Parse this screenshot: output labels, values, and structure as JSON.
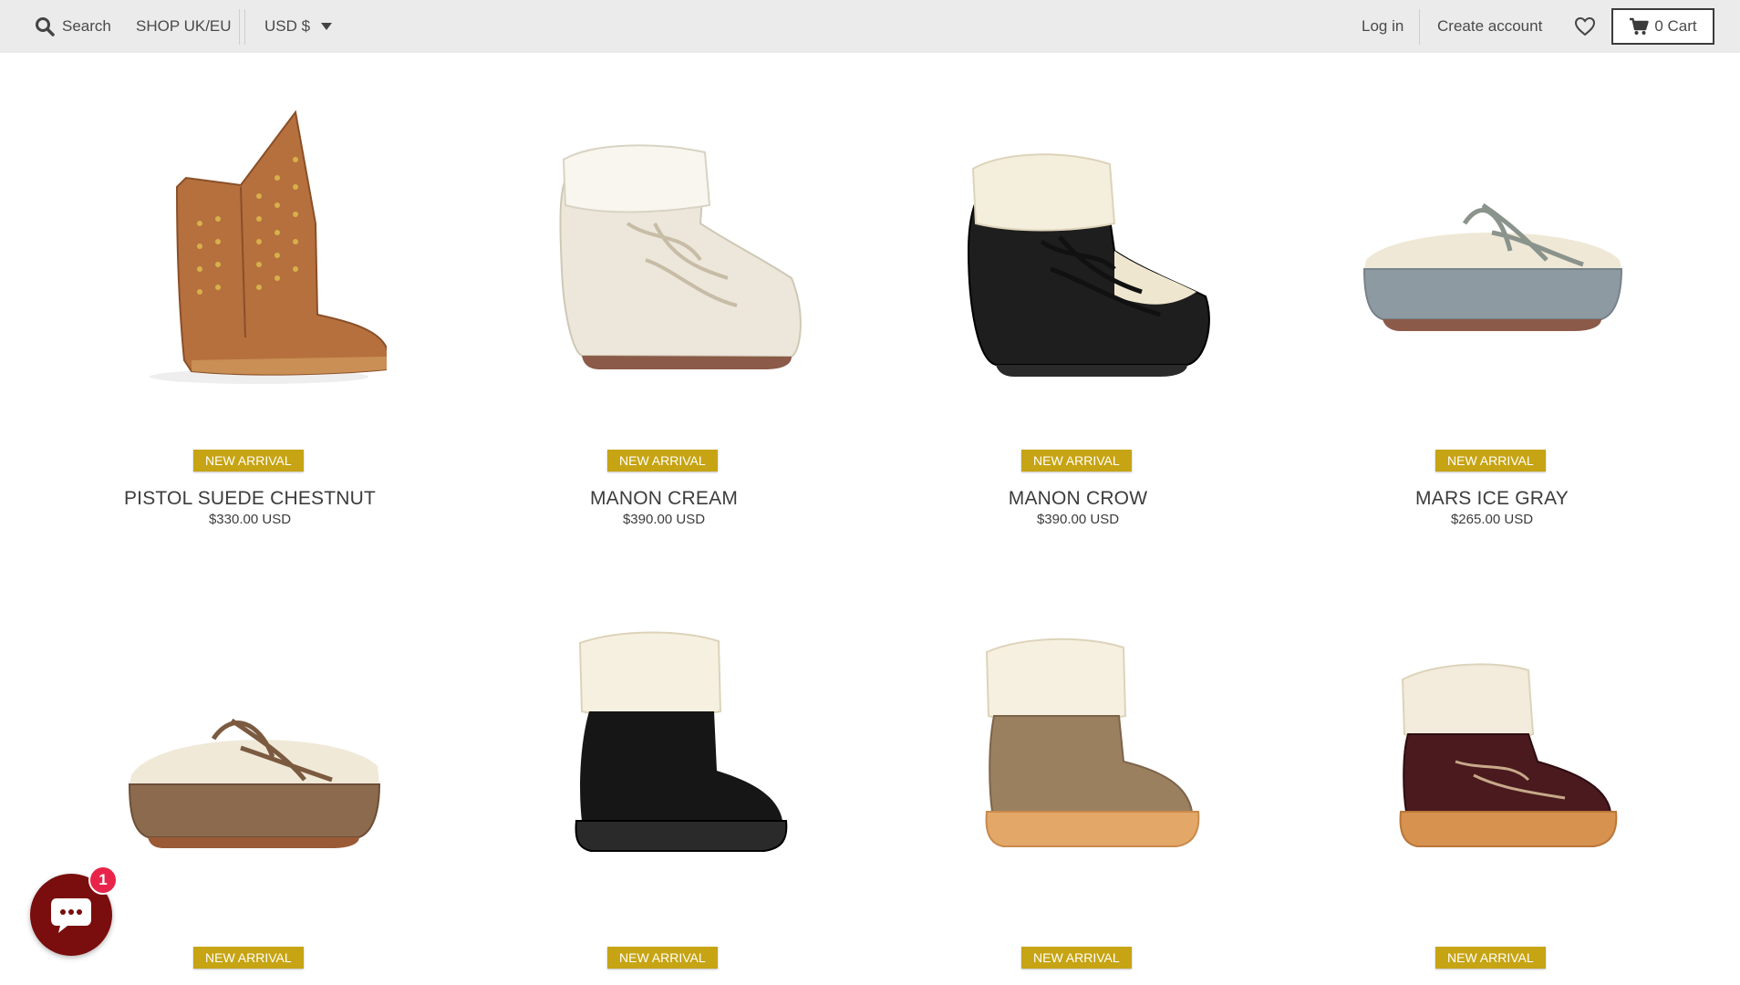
{
  "header": {
    "search_label": "Search",
    "region_label": "SHOP UK/EU",
    "currency_label": "USD $",
    "login_label": "Log in",
    "create_account_label": "Create account",
    "cart_label": "0 Cart"
  },
  "products": [
    {
      "badge": "NEW ARRIVAL",
      "name": "PISTOL SUEDE CHESTNUT",
      "price": "$330.00 USD"
    },
    {
      "badge": "NEW ARRIVAL",
      "name": "MANON CREAM",
      "price": "$390.00 USD"
    },
    {
      "badge": "NEW ARRIVAL",
      "name": "MANON CROW",
      "price": "$390.00 USD"
    },
    {
      "badge": "NEW ARRIVAL",
      "name": "MARS ICE GRAY",
      "price": "$265.00 USD"
    },
    {
      "badge": "NEW ARRIVAL"
    },
    {
      "badge": "NEW ARRIVAL"
    },
    {
      "badge": "NEW ARRIVAL"
    },
    {
      "badge": "NEW ARRIVAL"
    }
  ],
  "chat": {
    "unread_count": "1"
  },
  "colors": {
    "badge": "#c6a414",
    "topbar": "#ebebeb",
    "chat": "#7a0d0d",
    "chat_badge": "#e8244a"
  }
}
